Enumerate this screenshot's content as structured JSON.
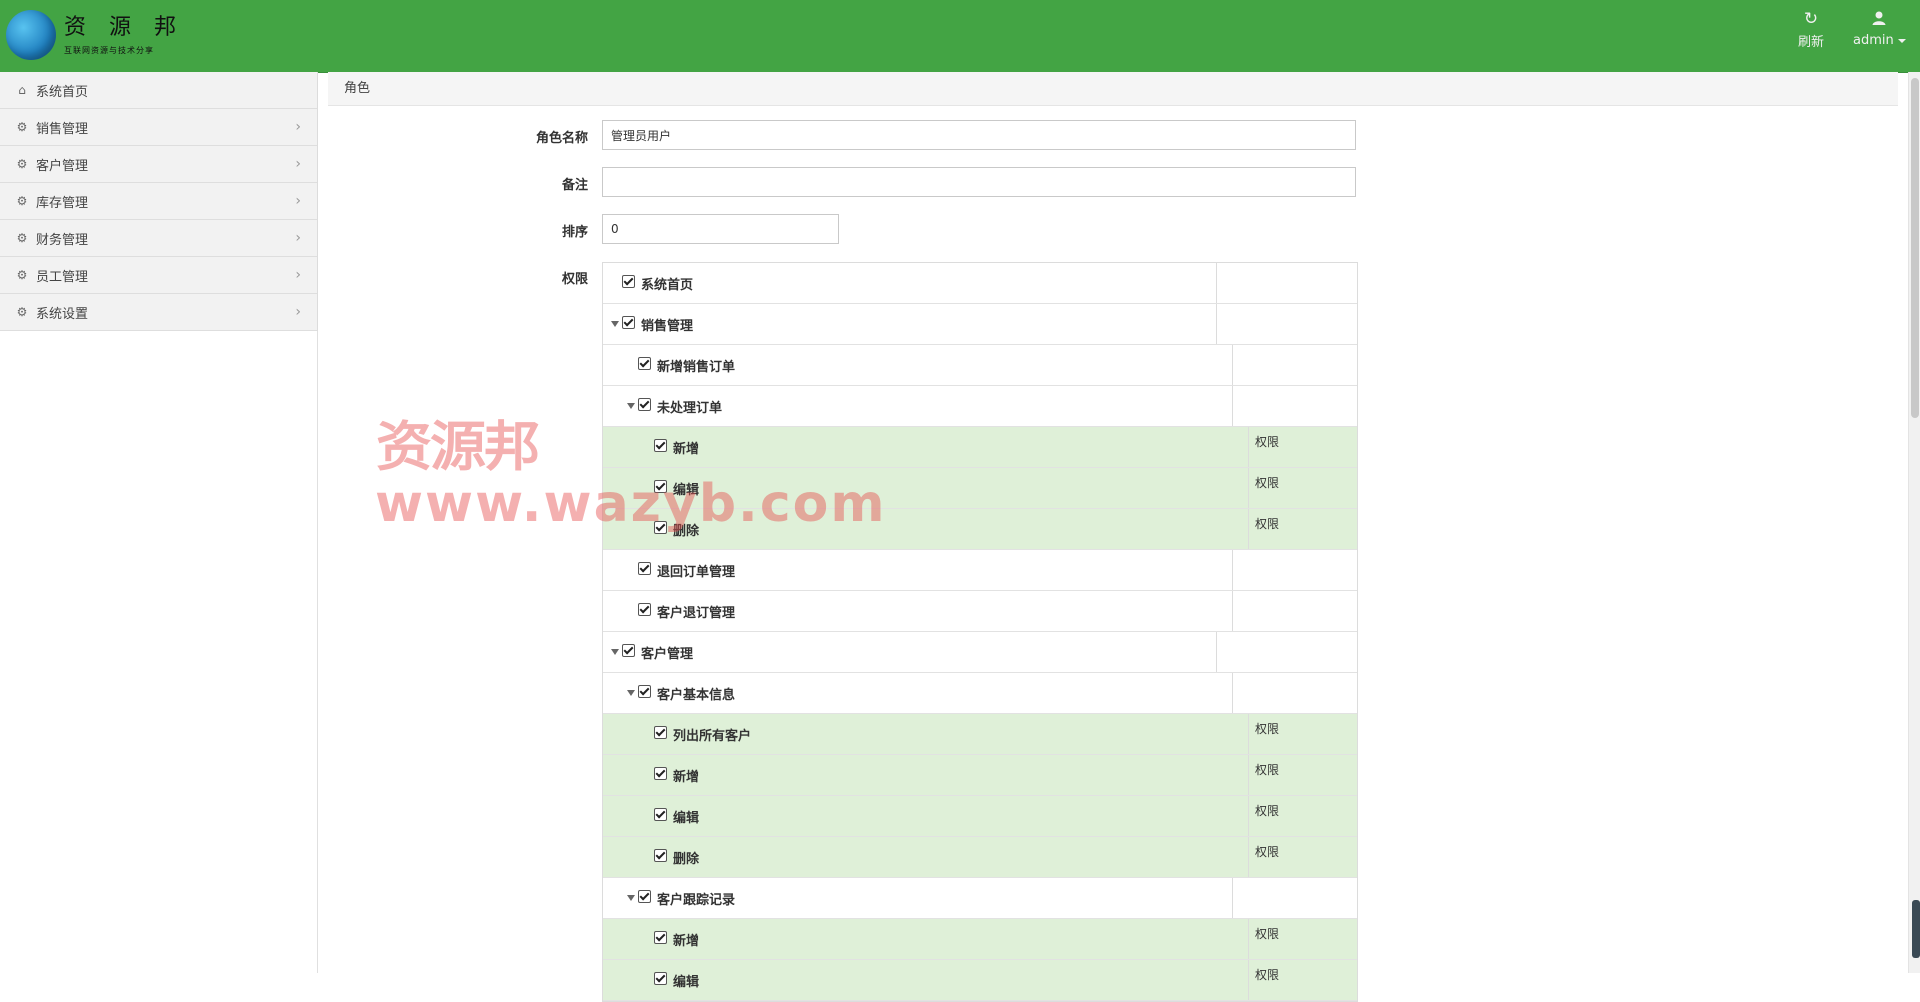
{
  "header": {
    "logo_title": "资 源 邦",
    "logo_subtitle": "互联网资源与技术分享",
    "refresh_label": "刷新",
    "user_label": "admin"
  },
  "sidebar": {
    "items": [
      {
        "label": "系统首页",
        "icon": "home-icon",
        "has_arrow": false
      },
      {
        "label": "销售管理",
        "icon": "gear-icon",
        "has_arrow": true
      },
      {
        "label": "客户管理",
        "icon": "gear-icon",
        "has_arrow": true
      },
      {
        "label": "库存管理",
        "icon": "gear-icon",
        "has_arrow": true
      },
      {
        "label": "财务管理",
        "icon": "gear-icon",
        "has_arrow": true
      },
      {
        "label": "员工管理",
        "icon": "gear-icon",
        "has_arrow": true
      },
      {
        "label": "系统设置",
        "icon": "gear-icon",
        "has_arrow": true
      }
    ]
  },
  "breadcrumb": "角色",
  "form": {
    "role_name_label": "角色名称",
    "role_name_value": "管理员用户",
    "remark_label": "备注",
    "remark_value": "",
    "sort_label": "排序",
    "sort_value": "0",
    "perm_label": "权限"
  },
  "permissions": [
    {
      "label": "系统首页",
      "level": 0,
      "expandable": false,
      "leaf": false,
      "checked": true,
      "right": ""
    },
    {
      "label": "销售管理",
      "level": 0,
      "expandable": true,
      "leaf": false,
      "checked": true,
      "right": ""
    },
    {
      "label": "新增销售订单",
      "level": 1,
      "expandable": false,
      "leaf": false,
      "checked": true,
      "right": ""
    },
    {
      "label": "未处理订单",
      "level": 1,
      "expandable": true,
      "leaf": false,
      "checked": true,
      "right": ""
    },
    {
      "label": "新增",
      "level": 2,
      "expandable": false,
      "leaf": true,
      "checked": true,
      "right": "权限"
    },
    {
      "label": "编辑",
      "level": 2,
      "expandable": false,
      "leaf": true,
      "checked": true,
      "right": "权限"
    },
    {
      "label": "删除",
      "level": 2,
      "expandable": false,
      "leaf": true,
      "checked": true,
      "right": "权限"
    },
    {
      "label": "退回订单管理",
      "level": 1,
      "expandable": false,
      "leaf": false,
      "checked": true,
      "right": ""
    },
    {
      "label": "客户退订管理",
      "level": 1,
      "expandable": false,
      "leaf": false,
      "checked": true,
      "right": ""
    },
    {
      "label": "客户管理",
      "level": 0,
      "expandable": true,
      "leaf": false,
      "checked": true,
      "right": ""
    },
    {
      "label": "客户基本信息",
      "level": 1,
      "expandable": true,
      "leaf": false,
      "checked": true,
      "right": ""
    },
    {
      "label": "列出所有客户",
      "level": 2,
      "expandable": false,
      "leaf": true,
      "checked": true,
      "right": "权限"
    },
    {
      "label": "新增",
      "level": 2,
      "expandable": false,
      "leaf": true,
      "checked": true,
      "right": "权限"
    },
    {
      "label": "编辑",
      "level": 2,
      "expandable": false,
      "leaf": true,
      "checked": true,
      "right": "权限"
    },
    {
      "label": "删除",
      "level": 2,
      "expandable": false,
      "leaf": true,
      "checked": true,
      "right": "权限"
    },
    {
      "label": "客户跟踪记录",
      "level": 1,
      "expandable": true,
      "leaf": false,
      "checked": true,
      "right": ""
    },
    {
      "label": "新增",
      "level": 2,
      "expandable": false,
      "leaf": true,
      "checked": true,
      "right": "权限"
    },
    {
      "label": "编辑",
      "level": 2,
      "expandable": false,
      "leaf": true,
      "checked": true,
      "right": "权限"
    }
  ],
  "watermark": {
    "line1": "资源邦",
    "line2": "www.wazyb.com"
  },
  "colors": {
    "header_bg": "#43a444",
    "leaf_row_bg": "#dff0d8"
  }
}
